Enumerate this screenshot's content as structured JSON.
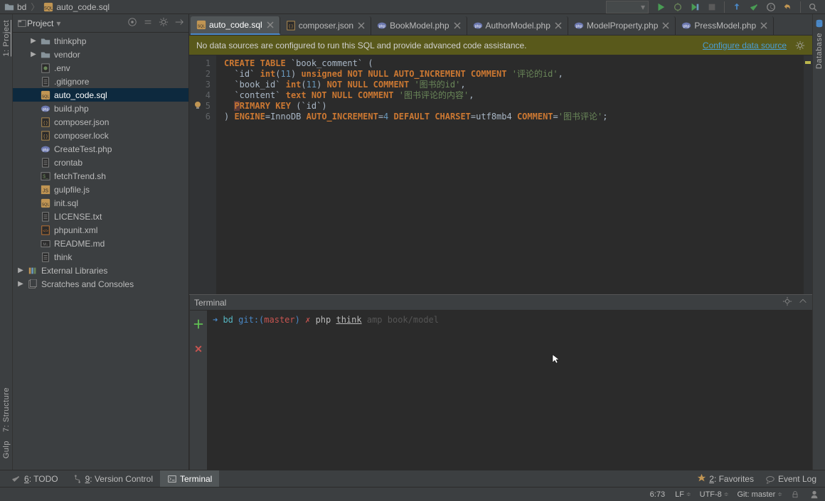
{
  "breadcrumb": {
    "project": "bd",
    "file": "auto_code.sql",
    "run_config_placeholder": ""
  },
  "project_panel": {
    "title": "Project",
    "tree": [
      {
        "depth": 1,
        "kind": "folder",
        "label": "thinkphp",
        "expandable": true,
        "expanded": false
      },
      {
        "depth": 1,
        "kind": "folder",
        "label": "vendor",
        "expandable": true,
        "expanded": false
      },
      {
        "depth": 1,
        "kind": "file",
        "icon": "env",
        "label": ".env"
      },
      {
        "depth": 1,
        "kind": "file",
        "icon": "text",
        "label": ".gitignore"
      },
      {
        "depth": 1,
        "kind": "file",
        "icon": "sql",
        "label": "auto_code.sql",
        "selected": true
      },
      {
        "depth": 1,
        "kind": "file",
        "icon": "php",
        "label": "build.php"
      },
      {
        "depth": 1,
        "kind": "file",
        "icon": "json",
        "label": "composer.json"
      },
      {
        "depth": 1,
        "kind": "file",
        "icon": "json",
        "label": "composer.lock"
      },
      {
        "depth": 1,
        "kind": "file",
        "icon": "php",
        "label": "CreateTest.php"
      },
      {
        "depth": 1,
        "kind": "file",
        "icon": "text",
        "label": "crontab"
      },
      {
        "depth": 1,
        "kind": "file",
        "icon": "sh",
        "label": "fetchTrend.sh"
      },
      {
        "depth": 1,
        "kind": "file",
        "icon": "js",
        "label": "gulpfile.js"
      },
      {
        "depth": 1,
        "kind": "file",
        "icon": "sql",
        "label": "init.sql"
      },
      {
        "depth": 1,
        "kind": "file",
        "icon": "text",
        "label": "LICENSE.txt"
      },
      {
        "depth": 1,
        "kind": "file",
        "icon": "xml",
        "label": "phpunit.xml"
      },
      {
        "depth": 1,
        "kind": "file",
        "icon": "md",
        "label": "README.md"
      },
      {
        "depth": 1,
        "kind": "file",
        "icon": "text",
        "label": "think"
      },
      {
        "depth": 0,
        "kind": "folder",
        "icon": "lib",
        "label": "External Libraries",
        "expandable": true,
        "expanded": false
      },
      {
        "depth": 0,
        "kind": "folder",
        "icon": "scratch",
        "label": "Scratches and Consoles",
        "expandable": true,
        "expanded": false
      }
    ]
  },
  "tabs": [
    {
      "icon": "sql",
      "label": "auto_code.sql",
      "active": true
    },
    {
      "icon": "json",
      "label": "composer.json",
      "active": false
    },
    {
      "icon": "php",
      "label": "BookModel.php",
      "active": false
    },
    {
      "icon": "php",
      "label": "AuthorModel.php",
      "active": false
    },
    {
      "icon": "php",
      "label": "ModelProperty.php",
      "active": false
    },
    {
      "icon": "php",
      "label": "PressModel.php",
      "active": false
    }
  ],
  "banner": {
    "text": "No data sources are configured to run this SQL and provide advanced code assistance.",
    "link": "Configure data source"
  },
  "code": {
    "lines": [
      {
        "n": 1,
        "html": "<span class='kw'>CREATE</span>&nbsp;<span class='kw'>TABLE</span> <span class='ident'>`book_comment`</span> <span class='op'>(</span>"
      },
      {
        "n": 2,
        "html": "&nbsp;&nbsp;<span class='ident'>`id`</span>&nbsp;<span class='kw'>int</span><span class='op'>(</span><span class='num'>11</span><span class='op'>)</span> <span class='kw'>unsigned</span> <span class='kw'>NOT</span> <span class='kw'>NULL</span> <span class='kw'>AUTO_INCREMENT</span> <span class='kw'>COMMENT</span> <span class='str'>'评论的id'</span><span class='op'>,</span>"
      },
      {
        "n": 3,
        "html": "&nbsp;&nbsp;<span class='ident'>`book_id`</span>&nbsp;<span class='kw'>int</span><span class='op'>(</span><span class='num'>11</span><span class='op'>)</span> <span class='kw'>NOT</span> <span class='kw'>NULL</span> <span class='kw'>COMMENT</span> <span class='str'>'图书的id'</span><span class='op'>,</span>"
      },
      {
        "n": 4,
        "html": "&nbsp;&nbsp;<span class='ident'>`content`</span>&nbsp;<span class='kw'>text</span> <span class='kw'>NOT</span> <span class='kw'>NULL</span> <span class='kw'>COMMENT</span> <span class='str'>'图书评论的内容'</span><span class='op'>,</span>"
      },
      {
        "n": 5,
        "html": "<span class='kw'>&nbsp;&nbsp;<span class='err'>P</span>RIMARY</span> <span class='kw'>KEY</span> <span class='op'>(</span><span class='ident'>`id`</span><span class='op'>)</span>",
        "bulb": true
      },
      {
        "n": 6,
        "html": "<span class='op'>)</span> <span class='kw'>ENGINE</span><span class='op'>=</span><span class='ident'>InnoDB</span> <span class='kw'>AUTO_INCREMENT</span><span class='op'>=</span><span class='num'>4</span> <span class='kw'>DEFAULT</span> <span class='kw'>CHARSET</span><span class='op'>=</span><span class='ident'>utf8mb4</span> <span class='kw'>COMMENT</span><span class='op'>=</span><span class='str'>'图书评论'</span><span class='op'>;</span>"
      }
    ]
  },
  "terminal": {
    "title": "Terminal",
    "prompt": {
      "dir": "bd",
      "git_label": "git:",
      "branch": "master",
      "after": "✗",
      "command": "php ",
      "think": "think",
      "hint": "amp book/model"
    }
  },
  "sidestrips": {
    "left_project": "1: Project",
    "left_structure": "7: Structure",
    "left_gulp": "Gulp",
    "right_db": "Database"
  },
  "bottom_tabs": {
    "todo_hotkey": "6",
    "todo": ": TODO",
    "vcs_hotkey": "9",
    "vcs": ": Version Control",
    "term": "Terminal",
    "fav_hotkey": "2",
    "favorites": ": Favorites",
    "eventlog": "Event Log"
  },
  "status": {
    "pos": "6:73",
    "line_end": "LF",
    "encoding": "UTF-8",
    "git": "Git: master"
  }
}
